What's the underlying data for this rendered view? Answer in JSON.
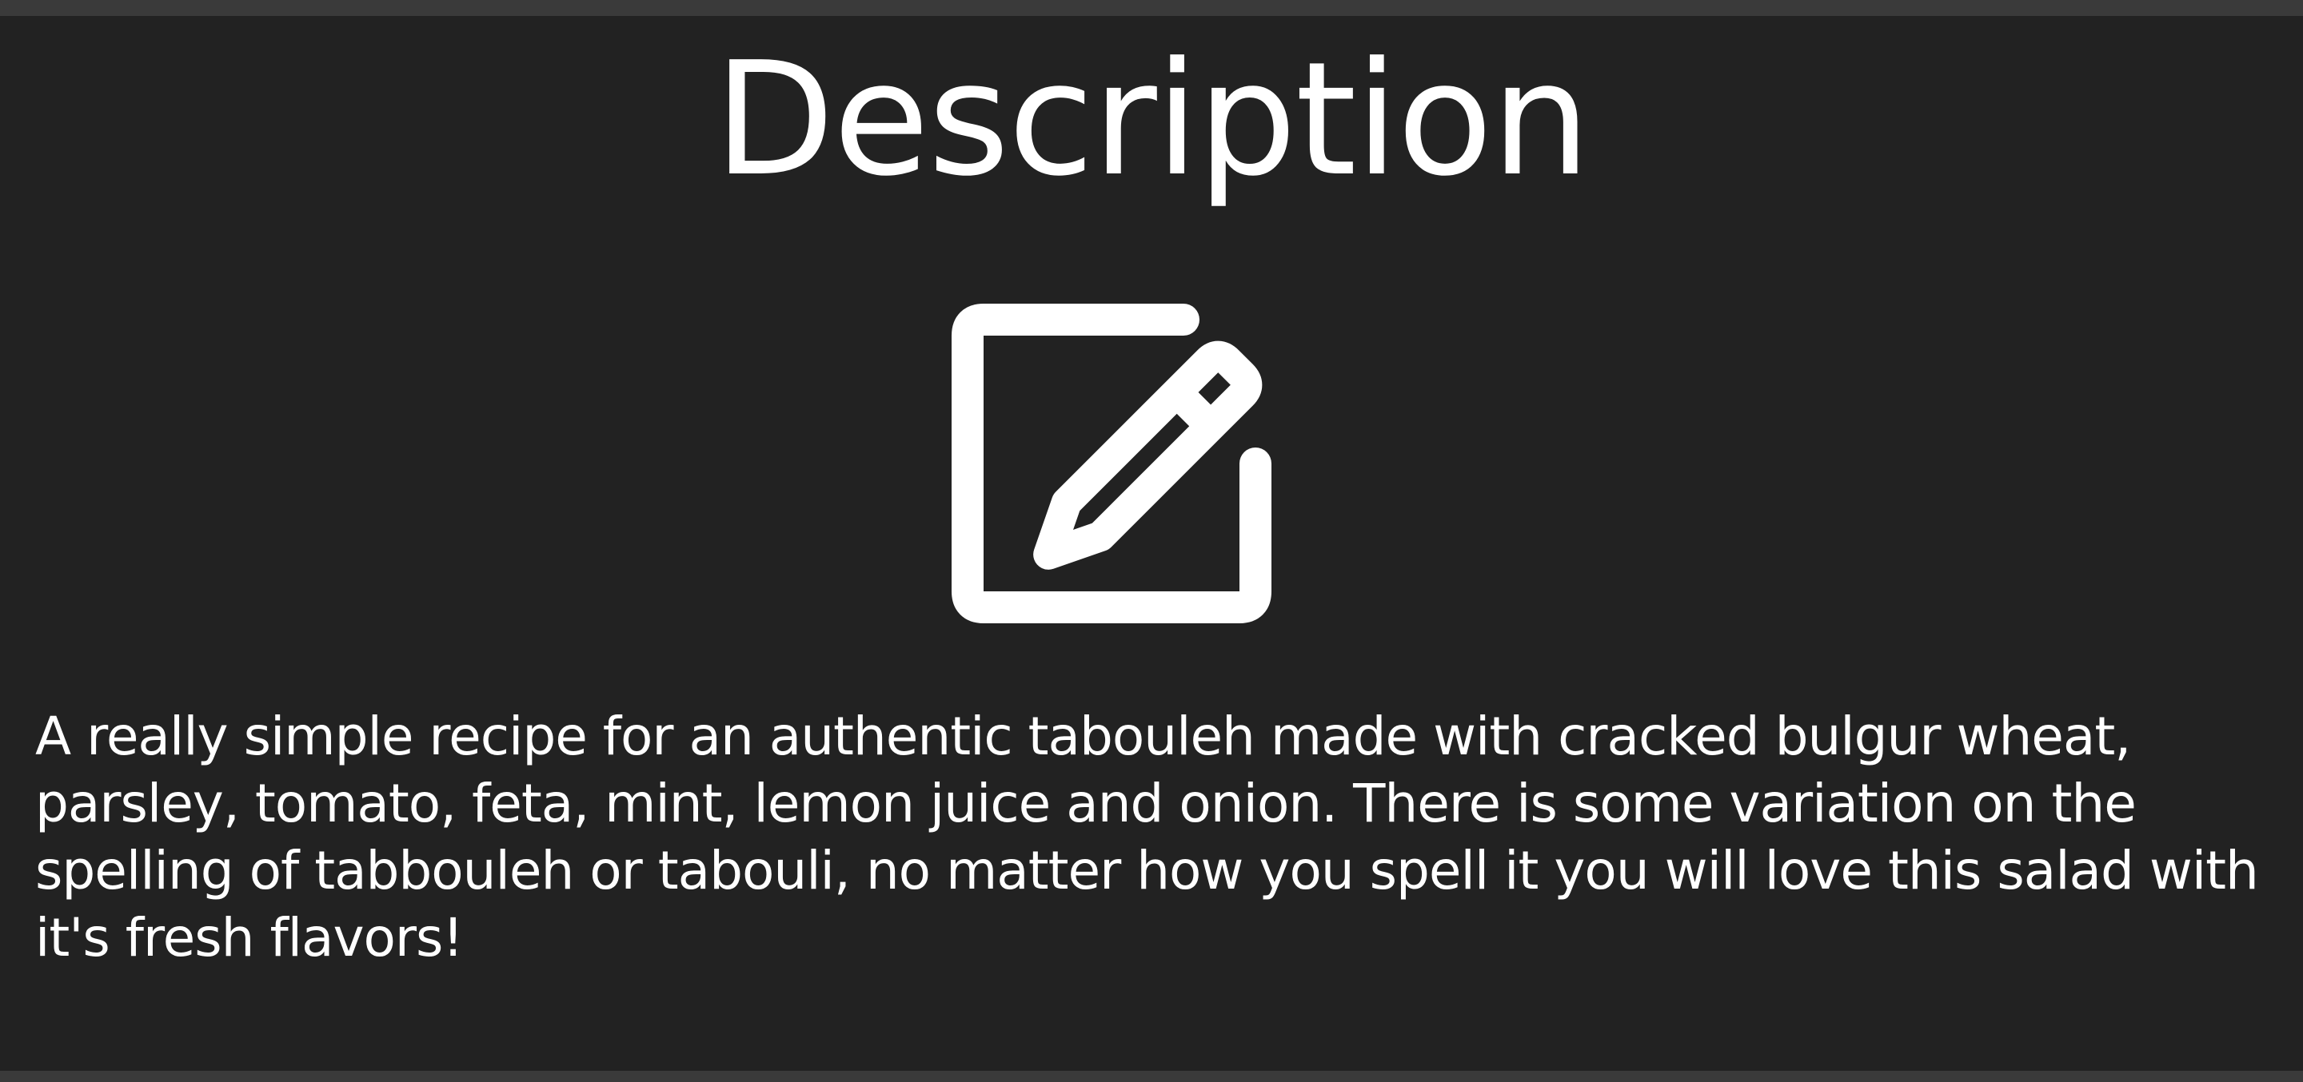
{
  "section": {
    "title": "Description",
    "icon": "edit-pencil-square-icon",
    "text": "A really simple recipe for an authentic tabouleh made with cracked bulgur wheat, parsley, tomato, feta, mint, lemon juice and onion. There is some variation on the spelling of tabbouleh or tabouli, no matter how you spell it you will love this salad with it's fresh flavors!"
  },
  "colors": {
    "background": "#222222",
    "frame": "#3a3a3a",
    "foreground": "#ffffff"
  }
}
